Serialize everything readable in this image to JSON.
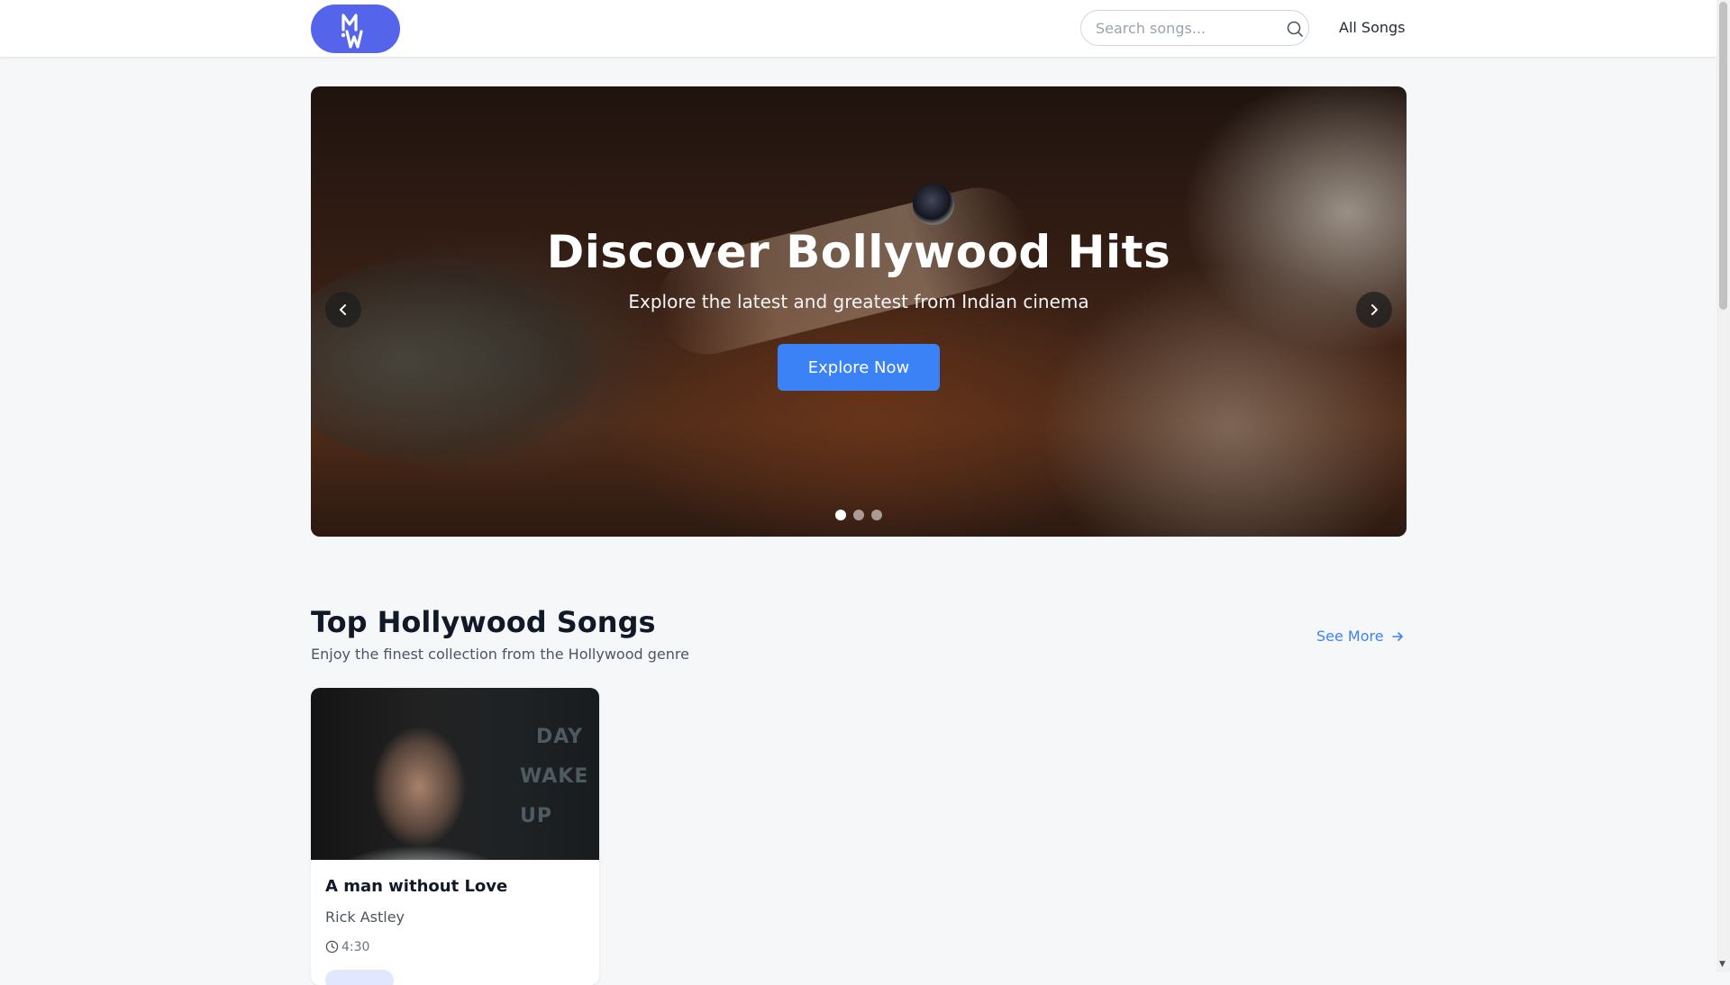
{
  "nav": {
    "logo_text": "MW",
    "search_placeholder": "Search songs...",
    "links": [
      {
        "label": "All Songs"
      }
    ]
  },
  "hero": {
    "title": "Discover Bollywood Hits",
    "subtitle": "Explore the latest and greatest from Indian cinema",
    "cta": "Explore Now",
    "slide_count": 3,
    "active_slide": 1
  },
  "section": {
    "title": "Top Hollywood Songs",
    "subtitle": "Enjoy the finest collection from the Hollywood genre",
    "see_more": "See More"
  },
  "songs": [
    {
      "title": "A man without Love",
      "artist": "Rick Astley",
      "duration": "4:30",
      "thumbnail_text": [
        "DAY",
        "WAKE",
        "UP"
      ]
    }
  ],
  "icons": {
    "search": "search-icon",
    "prev": "chevron-left-icon",
    "next": "chevron-right-icon",
    "see_more": "arrow-right-icon",
    "duration": "clock-icon"
  },
  "colors": {
    "brand": "#5465ec",
    "accent": "#3b82f6",
    "background": "#f6f7f9"
  }
}
